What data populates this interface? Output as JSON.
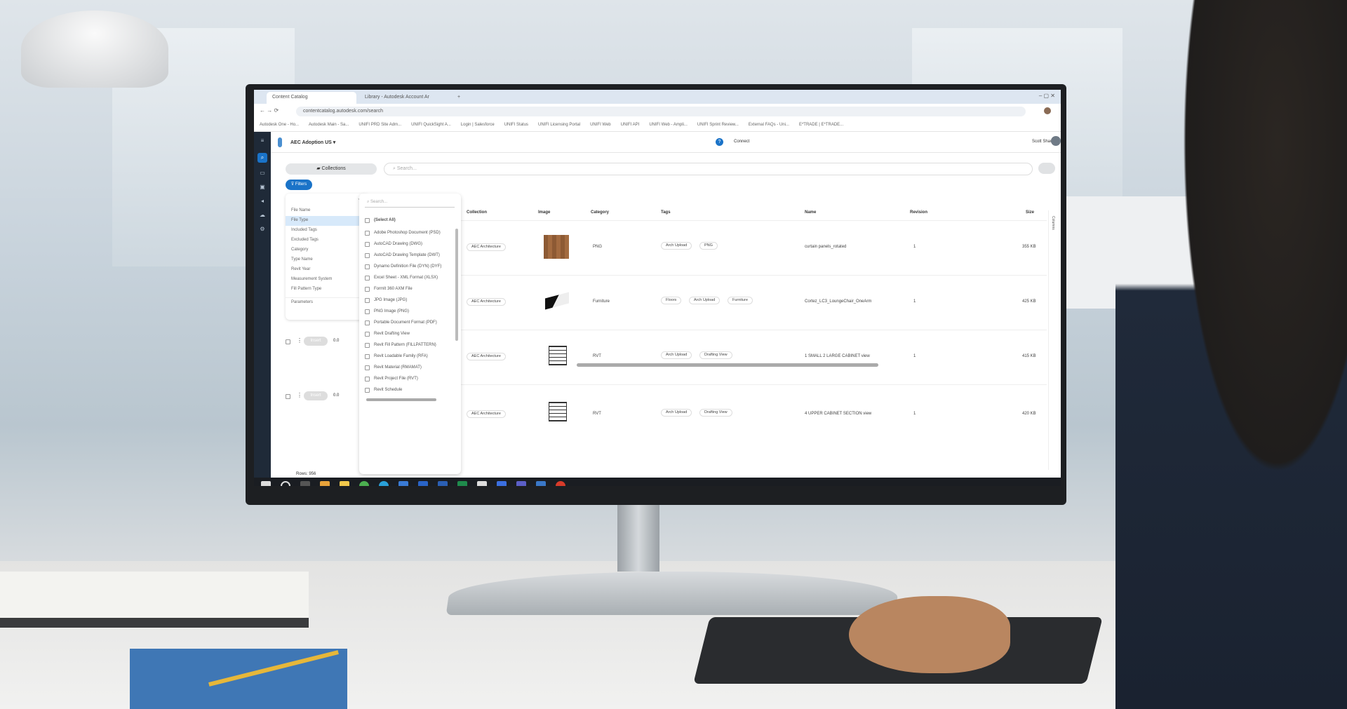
{
  "browser": {
    "tabs": [
      {
        "label": "Content Catalog"
      },
      {
        "label": "Library - Autodesk Account Ar"
      }
    ],
    "new_tab": "+",
    "url": "contentcatalog.autodesk.com/search",
    "bookmarks": [
      "Autodesk One - Ho...",
      "Autodesk Main - Sa...",
      "UNIFI PRD Site Adm...",
      "UNIFI QuickSight A...",
      "Login | Salesforce",
      "UNIFI Status",
      "UNIFI Licensing Portal",
      "UNIFI Web",
      "UNIFI API",
      "UNIFI Web - Ampli...",
      "UNIFI Sprint Review...",
      "External FAQs - Uni...",
      "E*TRADE | E*TRADE..."
    ]
  },
  "app": {
    "account": "AEC Adoption US ▾",
    "connect": "Connect",
    "user": "Scott Shaw",
    "help": "?",
    "collections_label": "Collections",
    "search_placeholder": "Search...",
    "filters_label": "Filters",
    "filter_categories": [
      "File Name",
      "File Type",
      "Included Tags",
      "Excluded Tags",
      "Category",
      "Type Name",
      "Revit Year",
      "Measurement System",
      "Fill Pattern Type",
      "Parameters"
    ],
    "dropdown": {
      "search_placeholder": "Search...",
      "select_all": "(Select All)",
      "options": [
        "Adobe Photoshop Document (PSD)",
        "AutoCAD Drawing (DWG)",
        "AutoCAD Drawing Template (DWT)",
        "Dynamo Definition File (DYN) (DYF)",
        "Excel Sheet - XML Format (XLSX)",
        "FormIt 360 AXM File",
        "JPG Image (JPG)",
        "PNG Image (PNG)",
        "Portable Document Format (PDF)",
        "Revit Drafting View",
        "Revit Fill Pattern (FILLPATTERN)",
        "Revit Loadable Family (RFA)",
        "Revit Material (RMAMAT)",
        "Revit Project File (RVT)",
        "Revit Schedule"
      ]
    },
    "table": {
      "columns": [
        "Collection",
        "Image",
        "Category",
        "Tags",
        "Name",
        "Revision",
        "Size"
      ],
      "rows": [
        {
          "collection": "AEC Architecture",
          "category": "PNG",
          "tags": [
            "Arch Upload",
            "PNG"
          ],
          "name": "curtain panels_rotated",
          "revision": "1",
          "size": "355 KB"
        },
        {
          "collection": "AEC Architecture",
          "category": "Furniture",
          "tags": [
            "Floors",
            "Arch Upload",
            "Furniture"
          ],
          "name": "Cortez_LC3_LoungeChair_OneArm",
          "revision": "1",
          "size": "425 KB"
        },
        {
          "collection": "AEC Architecture",
          "category": "RVT",
          "tags": [
            "Arch Upload",
            "Drafting View"
          ],
          "name": "1 SMALL 2 LARGE CABINET view",
          "revision": "1",
          "size": "415 KB"
        },
        {
          "collection": "AEC Architecture",
          "category": "RVT",
          "tags": [
            "Arch Upload",
            "Drafting View"
          ],
          "name": "4 UPPER CABINET SECTION view",
          "revision": "1",
          "size": "420 KB"
        }
      ],
      "row_action": "Insert",
      "row_value": "0.0",
      "rows_count": "Rows: 956",
      "side_panel": "Columns"
    },
    "colors": {
      "accent": "#1a73c8",
      "sidebar": "#1f2a38",
      "taskbar": "#1a1d22"
    }
  }
}
